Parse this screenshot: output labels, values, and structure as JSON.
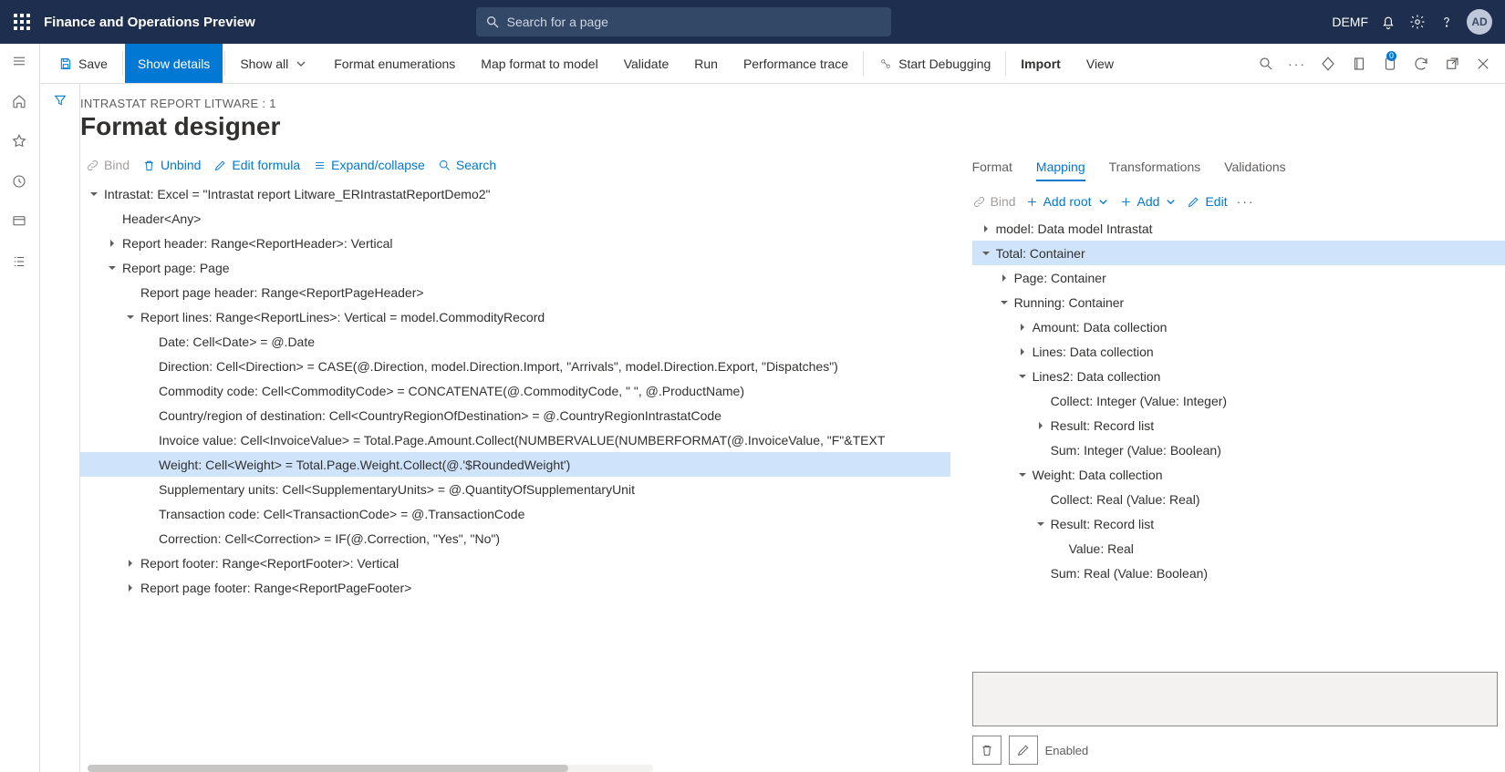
{
  "header": {
    "app_title": "Finance and Operations Preview",
    "search_placeholder": "Search for a page",
    "company": "DEMF",
    "avatar": "AD"
  },
  "commandbar": {
    "save": "Save",
    "show_details": "Show details",
    "show_all": "Show all",
    "format_enum": "Format enumerations",
    "map_format": "Map format to model",
    "validate": "Validate",
    "run": "Run",
    "perf": "Performance trace",
    "start_debug": "Start Debugging",
    "import": "Import",
    "view": "View"
  },
  "page": {
    "breadcrumb": "INTRASTAT REPORT LITWARE : 1",
    "title": "Format designer"
  },
  "left_toolbar": {
    "bind": "Bind",
    "unbind": "Unbind",
    "edit_formula": "Edit formula",
    "expand": "Expand/collapse",
    "search": "Search"
  },
  "left_tree": [
    {
      "ind": 0,
      "exp": "open",
      "text": "Intrastat: Excel = \"Intrastat report Litware_ERIntrastatReportDemo2\""
    },
    {
      "ind": 1,
      "exp": "none",
      "text": "Header<Any>"
    },
    {
      "ind": 1,
      "exp": "closed",
      "text": "Report header: Range<ReportHeader>: Vertical"
    },
    {
      "ind": 1,
      "exp": "open",
      "text": "Report page: Page"
    },
    {
      "ind": 2,
      "exp": "none",
      "text": "Report page header: Range<ReportPageHeader>"
    },
    {
      "ind": 2,
      "exp": "open",
      "text": "Report lines: Range<ReportLines>: Vertical = model.CommodityRecord"
    },
    {
      "ind": 3,
      "exp": "none",
      "text": "Date: Cell<Date> = @.Date"
    },
    {
      "ind": 3,
      "exp": "none",
      "text": "Direction: Cell<Direction> = CASE(@.Direction, model.Direction.Import, \"Arrivals\", model.Direction.Export, \"Dispatches\")"
    },
    {
      "ind": 3,
      "exp": "none",
      "text": "Commodity code: Cell<CommodityCode> = CONCATENATE(@.CommodityCode, \" \", @.ProductName)"
    },
    {
      "ind": 3,
      "exp": "none",
      "text": "Country/region of destination: Cell<CountryRegionOfDestination> = @.CountryRegionIntrastatCode"
    },
    {
      "ind": 3,
      "exp": "none",
      "text": "Invoice value: Cell<InvoiceValue> = Total.Page.Amount.Collect(NUMBERVALUE(NUMBERFORMAT(@.InvoiceValue, \"F\"&TEXT"
    },
    {
      "ind": 3,
      "exp": "none",
      "text": "Weight: Cell<Weight> = Total.Page.Weight.Collect(@.'$RoundedWeight')",
      "selected": true
    },
    {
      "ind": 3,
      "exp": "none",
      "text": "Supplementary units: Cell<SupplementaryUnits> = @.QuantityOfSupplementaryUnit"
    },
    {
      "ind": 3,
      "exp": "none",
      "text": "Transaction code: Cell<TransactionCode> = @.TransactionCode"
    },
    {
      "ind": 3,
      "exp": "none",
      "text": "Correction: Cell<Correction> = IF(@.Correction, \"Yes\", \"No\")"
    },
    {
      "ind": 2,
      "exp": "closed",
      "text": "Report footer: Range<ReportFooter>: Vertical"
    },
    {
      "ind": 2,
      "exp": "closed",
      "text": "Report page footer: Range<ReportPageFooter>"
    }
  ],
  "right_tabs": {
    "format": "Format",
    "mapping": "Mapping",
    "transformations": "Transformations",
    "validations": "Validations"
  },
  "right_toolbar": {
    "bind": "Bind",
    "add_root": "Add root",
    "add": "Add",
    "edit": "Edit"
  },
  "right_tree": [
    {
      "ind": 0,
      "exp": "closed",
      "text": "model: Data model Intrastat"
    },
    {
      "ind": 0,
      "exp": "open",
      "text": "Total: Container",
      "selected": true
    },
    {
      "ind": 1,
      "exp": "closed",
      "text": "Page: Container"
    },
    {
      "ind": 1,
      "exp": "open",
      "text": "Running: Container"
    },
    {
      "ind": 2,
      "exp": "closed",
      "text": "Amount: Data collection"
    },
    {
      "ind": 2,
      "exp": "closed",
      "text": "Lines: Data collection"
    },
    {
      "ind": 2,
      "exp": "open",
      "text": "Lines2: Data collection"
    },
    {
      "ind": 3,
      "exp": "none",
      "text": "Collect: Integer (Value: Integer)"
    },
    {
      "ind": 3,
      "exp": "closed",
      "text": "Result: Record list"
    },
    {
      "ind": 3,
      "exp": "none",
      "text": "Sum: Integer (Value: Boolean)"
    },
    {
      "ind": 2,
      "exp": "open",
      "text": "Weight: Data collection"
    },
    {
      "ind": 3,
      "exp": "none",
      "text": "Collect: Real (Value: Real)"
    },
    {
      "ind": 3,
      "exp": "open",
      "text": "Result: Record list"
    },
    {
      "ind": 4,
      "exp": "none",
      "text": "Value: Real"
    },
    {
      "ind": 3,
      "exp": "none",
      "text": "Sum: Real (Value: Boolean)"
    }
  ],
  "right_bottom": {
    "enabled": "Enabled"
  }
}
